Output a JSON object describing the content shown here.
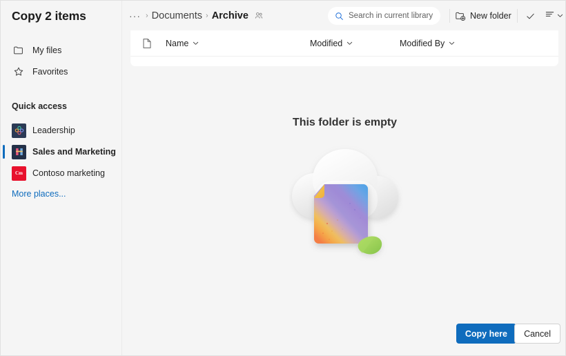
{
  "dialog": {
    "title": "Copy 2 items"
  },
  "sidebar": {
    "nav": [
      {
        "label": "My files",
        "icon": "folder-icon"
      },
      {
        "label": "Favorites",
        "icon": "star-icon"
      }
    ],
    "quick_access_header": "Quick access",
    "quick_access": [
      {
        "label": "Leadership",
        "icon": "site-tile-icon",
        "selected": false
      },
      {
        "label": "Sales and Marketing",
        "icon": "site-tile-icon",
        "selected": true
      },
      {
        "label": "Contoso marketing",
        "icon": "site-tile-icon",
        "tile_text": "Cm",
        "selected": false
      }
    ],
    "more_places_label": "More places...",
    "accent_color": "#0f6cbd",
    "link_color": "#0f6cbd"
  },
  "toolbar": {
    "breadcrumb": {
      "overflow": "···",
      "separator": "›",
      "items": [
        {
          "label": "Documents",
          "current": false
        },
        {
          "label": "Archive",
          "current": true,
          "shared": true
        }
      ]
    },
    "search": {
      "placeholder": "Search in current library",
      "icon": "search-icon",
      "icon_color": "#1e6fd9"
    },
    "new_folder_label": "New folder",
    "new_folder_icon": "folder-add-icon",
    "check_icon": "checkmark-icon",
    "view_icon": "view-options-icon",
    "view_chevron_icon": "chevron-down-icon"
  },
  "file_list": {
    "doc_icon": "document-icon",
    "columns": [
      {
        "label": "Name",
        "sort_icon": "chevron-down-icon"
      },
      {
        "label": "Modified",
        "sort_icon": "chevron-down-icon"
      },
      {
        "label": "Modified By",
        "sort_icon": "chevron-down-icon"
      }
    ],
    "rows": []
  },
  "empty_state": {
    "title": "This folder is empty",
    "illustration": "cloud-with-file-and-cursor-illustration"
  },
  "footer": {
    "primary_label": "Copy here",
    "primary_color": "#0f6cbd",
    "secondary_label": "Cancel"
  }
}
